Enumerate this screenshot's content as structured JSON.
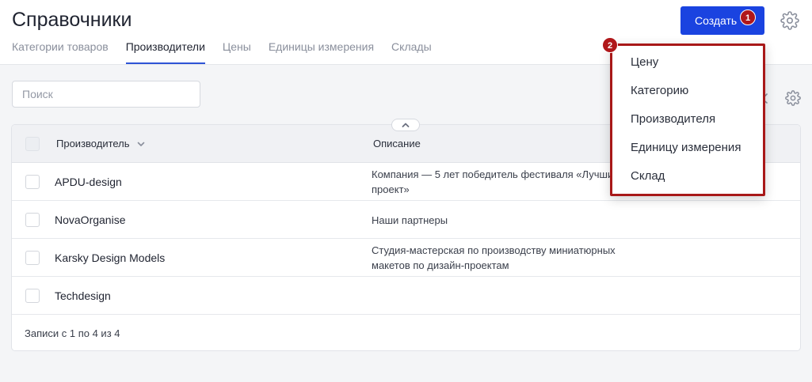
{
  "header": {
    "title": "Справочники",
    "create_label": "Создать",
    "badge_create": "1",
    "badge_menu": "2"
  },
  "tabs": [
    {
      "label": "Категории товаров",
      "active": false
    },
    {
      "label": "Производители",
      "active": true
    },
    {
      "label": "Цены",
      "active": false
    },
    {
      "label": "Единицы измерения",
      "active": false
    },
    {
      "label": "Склады",
      "active": false
    }
  ],
  "search": {
    "placeholder": "Поиск",
    "value": ""
  },
  "table": {
    "columns": [
      "Производитель",
      "Описание"
    ],
    "rows": [
      {
        "name": "APDU-design",
        "description": "Компания — 5 лет победитель фестиваля «Лучший проект»"
      },
      {
        "name": "NovaOrganise",
        "description": "Наши партнеры"
      },
      {
        "name": "Karsky Design Models",
        "description": "Студия-мастерская по производству миниатюрных макетов по дизайн-проектам"
      },
      {
        "name": "Techdesign",
        "description": ""
      }
    ],
    "footer": "Записи с 1 по 4 из 4"
  },
  "dropdown": {
    "items": [
      "Цену",
      "Категорию",
      "Производителя",
      "Единицу измерения",
      "Склад"
    ]
  },
  "colors": {
    "accent": "#1a43e0",
    "highlight": "#a81818",
    "badge": "#b0171a"
  },
  "icons": [
    "gear-icon",
    "close-icon",
    "chevron-down-icon",
    "chevron-up-icon"
  ]
}
